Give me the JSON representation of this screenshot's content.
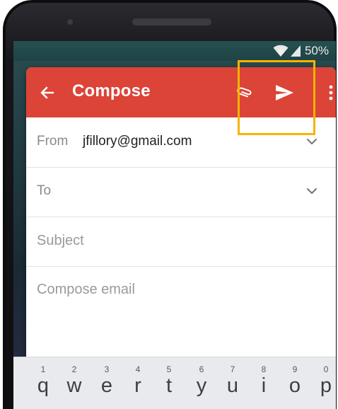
{
  "status_bar": {
    "battery_text": "50%",
    "icons": [
      "wifi-icon",
      "signal-icon",
      "battery-icon"
    ]
  },
  "toolbar": {
    "title": "Compose",
    "background_color": "#db4437",
    "icons": [
      "back-arrow-icon",
      "paperclip-icon",
      "send-icon",
      "more-vert-icon"
    ]
  },
  "form": {
    "from_label": "From",
    "from_value": "jfillory@gmail.com",
    "to_label": "To",
    "subject_placeholder": "Subject",
    "body_placeholder": "Compose email"
  },
  "keyboard": {
    "keys": [
      {
        "num": "1",
        "letter": "q"
      },
      {
        "num": "2",
        "letter": "w"
      },
      {
        "num": "3",
        "letter": "e"
      },
      {
        "num": "4",
        "letter": "r"
      },
      {
        "num": "5",
        "letter": "t"
      },
      {
        "num": "6",
        "letter": "y"
      },
      {
        "num": "7",
        "letter": "u"
      },
      {
        "num": "8",
        "letter": "i"
      },
      {
        "num": "9",
        "letter": "o"
      },
      {
        "num": "0",
        "letter": "p"
      }
    ]
  },
  "annotation": {
    "highlight_color": "#f5b400",
    "target": "send-button"
  }
}
